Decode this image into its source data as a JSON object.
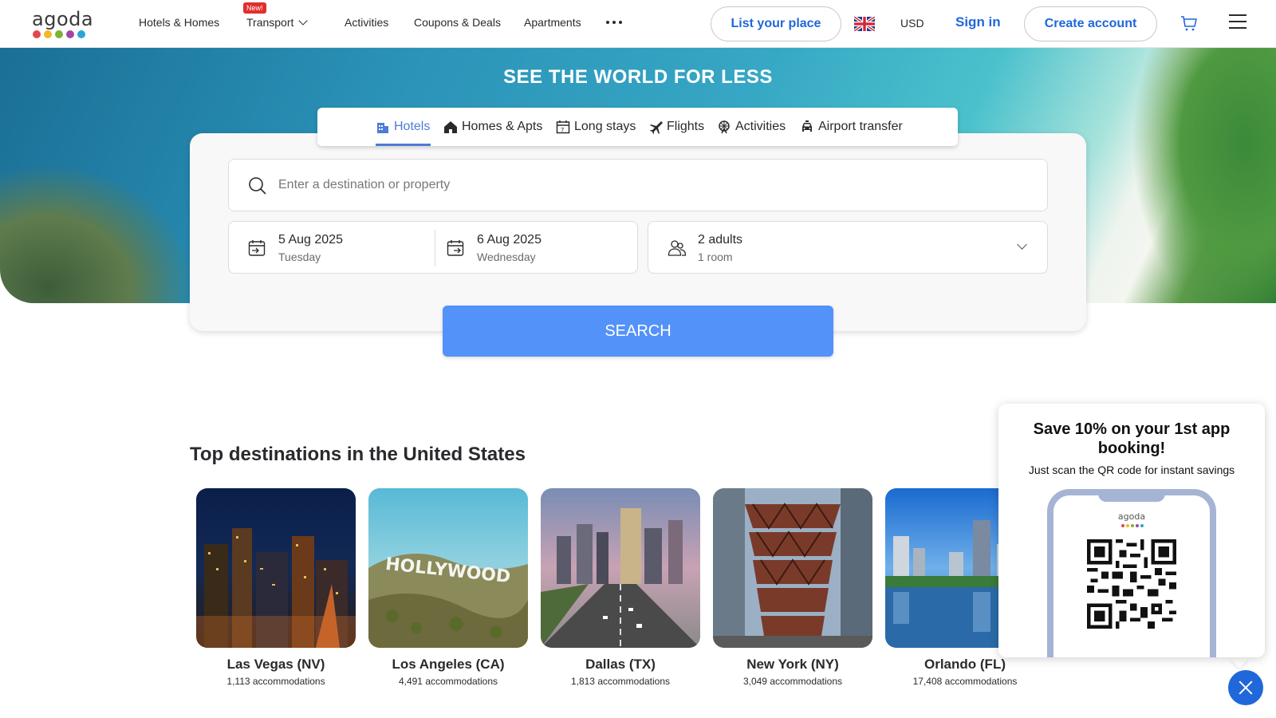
{
  "header": {
    "logo_text": "agoda",
    "logo_dot_colors": [
      "#e0474c",
      "#f4b822",
      "#7fb135",
      "#a346a3",
      "#2ca4d8"
    ],
    "nav": [
      {
        "label": "Hotels & Homes"
      },
      {
        "label": "Transport",
        "badge": "New!",
        "has_dropdown": true
      },
      {
        "label": "Activities"
      },
      {
        "label": "Coupons & Deals"
      },
      {
        "label": "Apartments"
      }
    ],
    "list_place_label": "List your place",
    "currency": "USD",
    "signin_label": "Sign in",
    "create_account_label": "Create account",
    "icons": {
      "more": "more-dots-icon",
      "flag": "uk-flag-icon",
      "cart": "cart-icon",
      "menu": "hamburger-menu-icon"
    }
  },
  "hero": {
    "title": "SEE THE WORLD FOR LESS"
  },
  "search": {
    "tabs": [
      {
        "label": "Hotels",
        "icon": "hotel-icon",
        "active": true
      },
      {
        "label": "Homes & Apts",
        "icon": "home-icon"
      },
      {
        "label": "Long stays",
        "icon": "calendar-icon"
      },
      {
        "label": "Flights",
        "icon": "plane-icon"
      },
      {
        "label": "Activities",
        "icon": "ferris-wheel-icon"
      },
      {
        "label": "Airport transfer",
        "icon": "car-icon"
      }
    ],
    "destination_placeholder": "Enter a destination or property",
    "destination_value": "",
    "checkin": {
      "date": "5 Aug 2025",
      "day": "Tuesday"
    },
    "checkout": {
      "date": "6 Aug 2025",
      "day": "Wednesday"
    },
    "guests": {
      "adults": "2 adults",
      "rooms": "1 room"
    },
    "button_label": "SEARCH",
    "accent_color": "#5392f9"
  },
  "destinations": {
    "title": "Top destinations in the United States",
    "items": [
      {
        "name": "Las Vegas (NV)",
        "count": "1,113 accommodations"
      },
      {
        "name": "Los Angeles (CA)",
        "count": "4,491 accommodations",
        "image_text": "HOLLYWOOD"
      },
      {
        "name": "Dallas (TX)",
        "count": "1,813 accommodations"
      },
      {
        "name": "New York (NY)",
        "count": "3,049 accommodations"
      },
      {
        "name": "Orlando (FL)",
        "count": "17,408 accommodations"
      }
    ]
  },
  "promo": {
    "title": "Save 10% on your 1st app booking!",
    "subtitle": "Just scan the QR code for instant savings",
    "phone_logo": "agoda",
    "close_icon": "close-icon"
  },
  "colors": {
    "brand_blue": "#2067da",
    "search_blue": "#5392f9",
    "tab_active": "#4d7bd6",
    "new_badge": "#e12d2d"
  }
}
